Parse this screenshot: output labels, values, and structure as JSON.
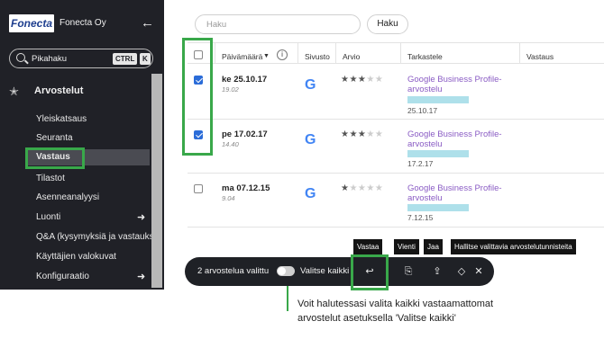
{
  "sidebar": {
    "logo": "Fonecta",
    "org_name": "Fonecta Oy",
    "search": {
      "placeholder": "Pikahaku",
      "kbd_ctrl": "CTRL",
      "kbd_k": "K"
    },
    "section_label": "Arvostelut",
    "items": [
      {
        "label": "Yleiskatsaus"
      },
      {
        "label": "Seuranta"
      },
      {
        "label": "Vastaus",
        "active": true
      },
      {
        "label": "Tilastot"
      },
      {
        "label": "Asenneanalyysi"
      },
      {
        "label": "Luonti",
        "arrow": true
      },
      {
        "label": "Q&A (kysymyksiä ja vastauks"
      },
      {
        "label": "Käyttäjien valokuvat"
      },
      {
        "label": "Konfiguraatio",
        "arrow": true
      }
    ]
  },
  "main": {
    "search_placeholder": "Haku",
    "search_button": "Haku",
    "columns": [
      "Päivämäärä",
      "Sivusto",
      "Arvio",
      "Tarkastele",
      "Vastaus"
    ],
    "rows": [
      {
        "date": "ke 25.10.17",
        "time": "19.02",
        "checked": true,
        "rating": 3,
        "link_line1": "Google Business Profile-",
        "link_line2": "arvostelu",
        "review_date": "25.10.17"
      },
      {
        "date": "pe 17.02.17",
        "time": "14.40",
        "checked": true,
        "rating": 3,
        "link_line1": "Google Business Profile-",
        "link_line2": "arvostelu",
        "review_date": "17.2.17"
      },
      {
        "date": "ma 07.12.15",
        "time": "9.04",
        "checked": false,
        "rating": 1,
        "link_line1": "Google Business Profile-",
        "link_line2": "arvostelu",
        "review_date": "7.12.15"
      }
    ]
  },
  "toolbar": {
    "selected_count": "2 arvostelua valittu",
    "select_all": "Valitse kaikki",
    "tooltips": {
      "reply": "Vastaa",
      "export": "Vienti",
      "share": "Jaa",
      "tags": "Hallitse valittavia arvostelutunnisteita"
    }
  },
  "callout": {
    "line1": "Voit halutessasi valita kaikki vastaamattomat",
    "line2": "arvostelut asetuksella 'Valitse kaikki'"
  },
  "colors": {
    "highlight": "#39a84a",
    "sidebar": "#202127",
    "link": "#8a5cc4",
    "checkbox": "#2b6cd8"
  }
}
